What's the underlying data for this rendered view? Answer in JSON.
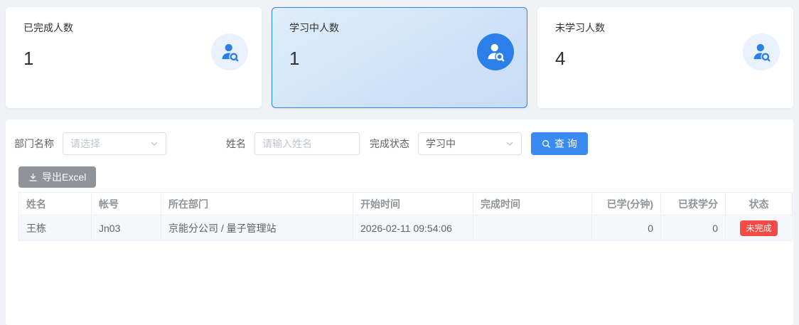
{
  "colors": {
    "accent_blue": "#3a8af2",
    "active_card_border": "#2f87e8",
    "icon_blue": "#2a7fe8",
    "icon_bg_light": "#e8f1fc",
    "export_gray": "#909399",
    "danger_red": "#f54a45",
    "page_bg": "#f0f2f5",
    "table_border": "#ebeef5"
  },
  "icons": {
    "stat": "user-search-icon",
    "query": "search-icon",
    "export": "download-icon",
    "select": "chevron-down-icon"
  },
  "stat_cards": [
    {
      "label": "已完成人数",
      "value": "1",
      "active": false
    },
    {
      "label": "学习中人数",
      "value": "1",
      "active": true
    },
    {
      "label": "未学习人数",
      "value": "4",
      "active": false
    }
  ],
  "filters": {
    "department": {
      "label": "部门名称",
      "placeholder": "请选择"
    },
    "name": {
      "label": "姓名",
      "placeholder": "请输入姓名",
      "value": ""
    },
    "status": {
      "label": "完成状态",
      "value": "学习中"
    },
    "query_label": "查 询"
  },
  "toolbar": {
    "export_label": "导出Excel"
  },
  "table": {
    "columns": [
      "姓名",
      "帐号",
      "所在部门",
      "开始时间",
      "完成时间",
      "已学(分钟)",
      "已获学分",
      "状态"
    ],
    "rows": [
      {
        "name": "王栋",
        "account": "Jn03",
        "department": "京能分公司 / 量子管理站",
        "start_time": "2026-02-11 09:54:06",
        "finish_time": "",
        "minutes": "0",
        "credits": "0",
        "status": "未完成"
      }
    ]
  }
}
